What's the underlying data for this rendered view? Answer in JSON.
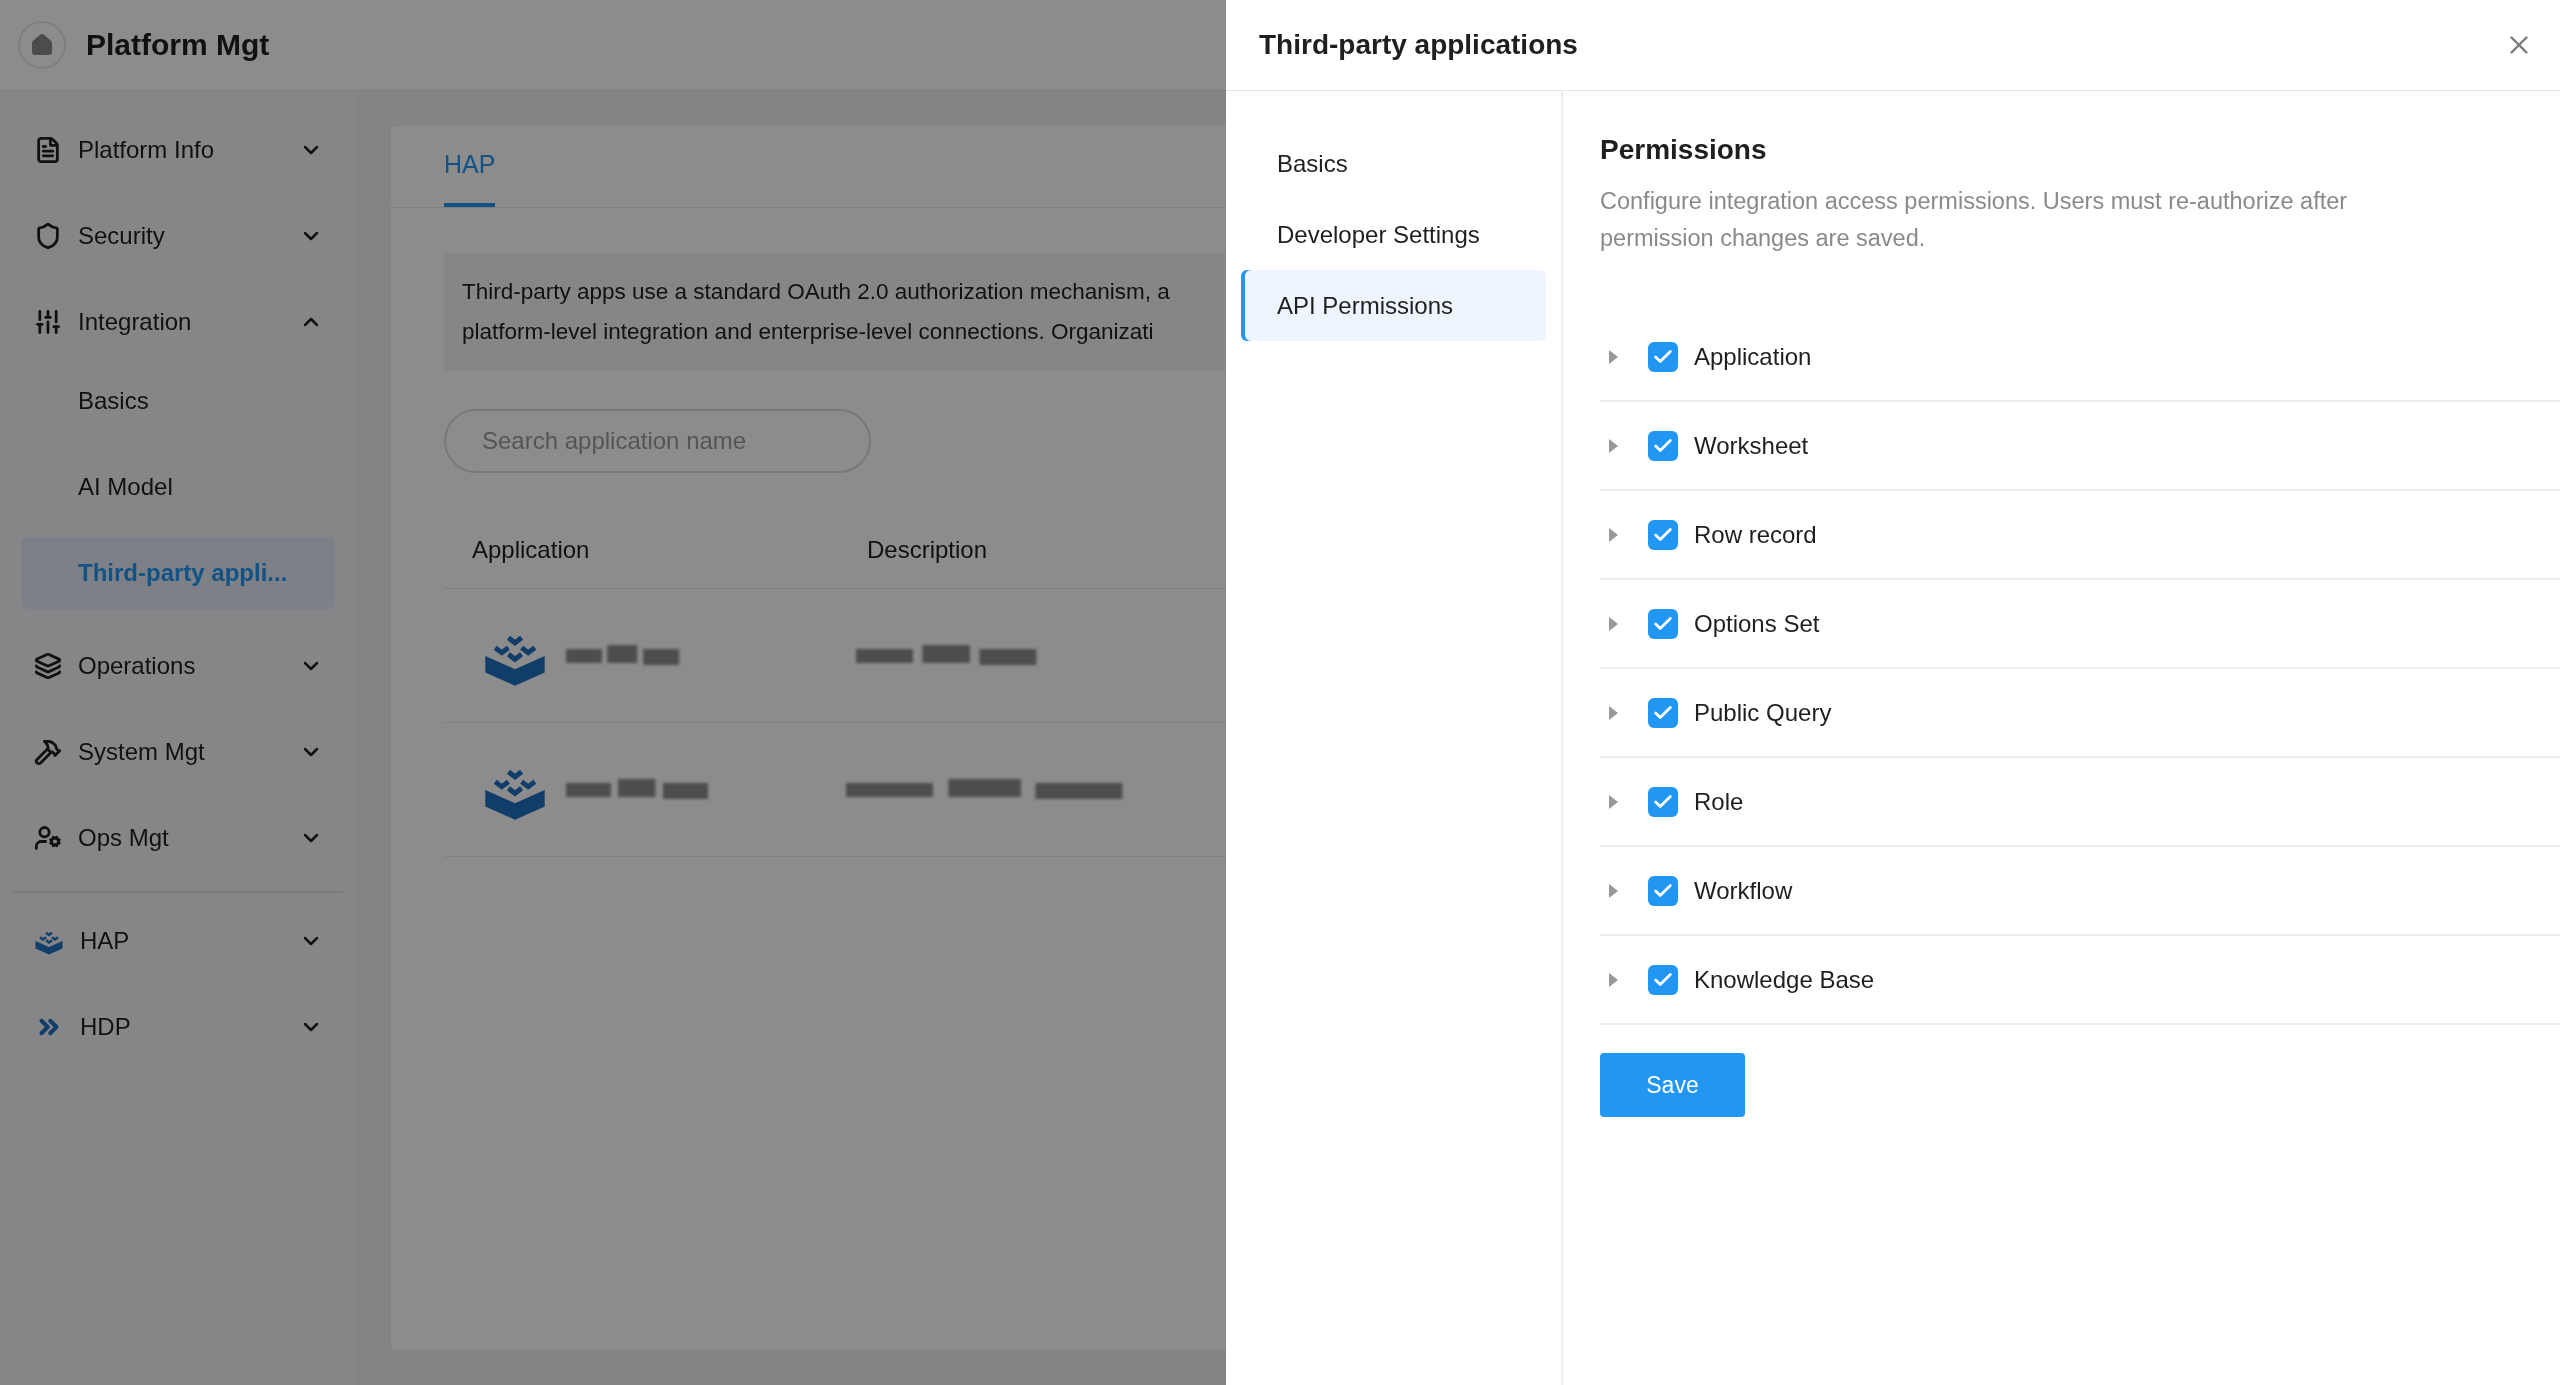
{
  "header": {
    "title": "Platform Mgt"
  },
  "sidebar": {
    "sections": [
      {
        "items": [
          {
            "label": "Platform Info",
            "expanded": false
          },
          {
            "label": "Security",
            "expanded": false
          },
          {
            "label": "Integration",
            "expanded": true,
            "children": [
              {
                "label": "Basics",
                "selected": false
              },
              {
                "label": "AI Model",
                "selected": false
              },
              {
                "label": "Third-party appli...",
                "selected": true
              }
            ]
          },
          {
            "label": "Operations",
            "expanded": false
          },
          {
            "label": "System Mgt",
            "expanded": false
          },
          {
            "label": "Ops Mgt",
            "expanded": false
          }
        ]
      },
      {
        "items": [
          {
            "label": "HAP",
            "expanded": false
          },
          {
            "label": "HDP",
            "expanded": false
          }
        ]
      }
    ]
  },
  "main": {
    "tabs": [
      {
        "label": "HAP",
        "selected": true
      }
    ],
    "banner": {
      "lines": [
        "Third-party apps use a standard OAuth 2.0 authorization mechanism, a",
        "platform-level integration and enterprise-level connections. Organizati"
      ]
    },
    "search": {
      "placeholder": "Search application name"
    },
    "table": {
      "columns": [
        "Application",
        "Description"
      ],
      "rows": [
        {
          "kind": "redacted"
        },
        {
          "kind": "redacted"
        }
      ]
    }
  },
  "drawer": {
    "title": "Third-party applications",
    "nav": [
      {
        "label": "Basics",
        "selected": false
      },
      {
        "label": "Developer Settings",
        "selected": false
      },
      {
        "label": "API Permissions",
        "selected": true
      }
    ],
    "section": {
      "title": "Permissions",
      "description": "Configure integration access permissions. Users must re-authorize after permission changes are saved.",
      "permissions": [
        {
          "label": "Application",
          "checked": true,
          "expanded": false
        },
        {
          "label": "Worksheet",
          "checked": true,
          "expanded": false
        },
        {
          "label": "Row record",
          "checked": true,
          "expanded": false
        },
        {
          "label": "Options Set",
          "checked": true,
          "expanded": false
        },
        {
          "label": "Public Query",
          "checked": true,
          "expanded": false
        },
        {
          "label": "Role",
          "checked": true,
          "expanded": false
        },
        {
          "label": "Workflow",
          "checked": true,
          "expanded": false
        },
        {
          "label": "Knowledge Base",
          "checked": true,
          "expanded": false
        }
      ],
      "save": "Save"
    }
  }
}
